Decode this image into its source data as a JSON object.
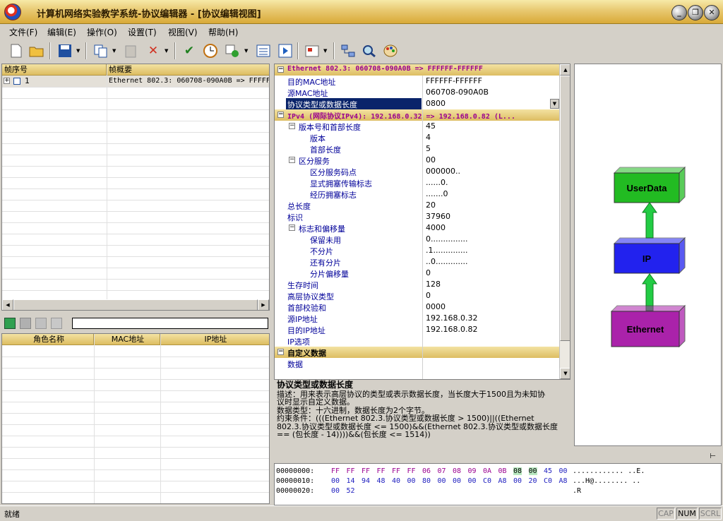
{
  "window": {
    "title": "计算机网络实验教学系统-协议编辑器 - [协议编辑视图]"
  },
  "menu": [
    "文件(F)",
    "编辑(E)",
    "操作(O)",
    "设置(T)",
    "视图(V)",
    "帮助(H)"
  ],
  "frames": {
    "col_no": "帧序号",
    "col_summary": "帧概要",
    "rows": [
      {
        "no": "1",
        "summary": "Ethernet 802.3: 060708-090A0B => FFFFF"
      }
    ]
  },
  "roles": {
    "col_name": "角色名称",
    "col_mac": "MAC地址",
    "col_ip": "IP地址",
    "search_value": ""
  },
  "props": {
    "eth_group": "Ethernet 802.3: 060708-090A0B => FFFFFF-FFFFFF",
    "eth_rows": [
      {
        "k": "目的MAC地址",
        "v": "FFFFFF-FFFFFF"
      },
      {
        "k": "源MAC地址",
        "v": "060708-090A0B"
      },
      {
        "k": "协议类型或数据长度",
        "v": "0800"
      }
    ],
    "ip_group": "IPv4 (网际协议IPv4): 192.168.0.32 => 192.168.0.82 (L...",
    "ip_rows": [
      {
        "k": "版本号和首部长度",
        "v": "45"
      },
      {
        "k": "版本",
        "v": "4"
      },
      {
        "k": "首部长度",
        "v": "5"
      },
      {
        "k": "区分服务",
        "v": "00"
      },
      {
        "k": "区分服务码点",
        "v": "000000.."
      },
      {
        "k": "显式拥塞传输标志",
        "v": "......0."
      },
      {
        "k": "经历拥塞标志",
        "v": ".......0"
      },
      {
        "k": "总长度",
        "v": "20"
      },
      {
        "k": "标识",
        "v": "37960"
      },
      {
        "k": "标志和偏移量",
        "v": "4000"
      },
      {
        "k": "保留未用",
        "v": "0..............."
      },
      {
        "k": "不分片",
        "v": ".1.............."
      },
      {
        "k": "还有分片",
        "v": "..0............."
      },
      {
        "k": "分片偏移量",
        "v": "0"
      },
      {
        "k": "生存时间",
        "v": "128"
      },
      {
        "k": "高层协议类型",
        "v": "0"
      },
      {
        "k": "首部校验和",
        "v": "0000"
      },
      {
        "k": "源IP地址",
        "v": "192.168.0.32"
      },
      {
        "k": "目的IP地址",
        "v": "192.168.0.82"
      },
      {
        "k": "IP选项",
        "v": ""
      }
    ],
    "custom_group": "自定义数据",
    "custom_rows": [
      {
        "k": "数据",
        "v": ""
      }
    ]
  },
  "description": {
    "title": "协议类型或数据长度",
    "lines": [
      "描述：用来表示高层协议的类型或表示数据长度，当长度大于1500且为未知协",
      "议时显示自定义数据。",
      "数据类型：十六进制，数据长度为2个字节。",
      "约束条件：(((Ethernet 802.3.协议类型或数据长度 > 1500)||((Ethernet",
      "802.3.协议类型或数据长度 <= 1500)&&(Ethernet 802.3.协议类型或数据长度",
      "== (包长度 - 14))))&&(包长度 <= 1514))"
    ]
  },
  "layers": {
    "top": "UserData",
    "middle": "IP",
    "bottom": "Ethernet",
    "colors": {
      "top": "#22bb22",
      "middle": "#2222ee",
      "bottom": "#aa22aa",
      "arrow": "#22cc44"
    }
  },
  "hex": {
    "lines": [
      {
        "offset": "00000000:",
        "bytes": [
          "FF",
          "FF",
          "FF",
          "FF",
          "FF",
          "FF",
          "06",
          "07",
          "08",
          "09",
          "0A",
          "0B",
          "08",
          "00",
          "45",
          "00"
        ],
        "ascii": "............ ..E."
      },
      {
        "offset": "00000010:",
        "bytes": [
          "00",
          "14",
          "94",
          "48",
          "40",
          "00",
          "80",
          "00",
          "00",
          "00",
          "C0",
          "A8",
          "00",
          "20",
          "C0",
          "A8"
        ],
        "ascii": "...H@........ .."
      },
      {
        "offset": "00000020:",
        "bytes": [
          "00",
          "52"
        ],
        "ascii": ".R"
      }
    ]
  },
  "status": {
    "text": "就绪",
    "caps": "CAP",
    "num": "NUM",
    "scrl": "SCRL"
  }
}
